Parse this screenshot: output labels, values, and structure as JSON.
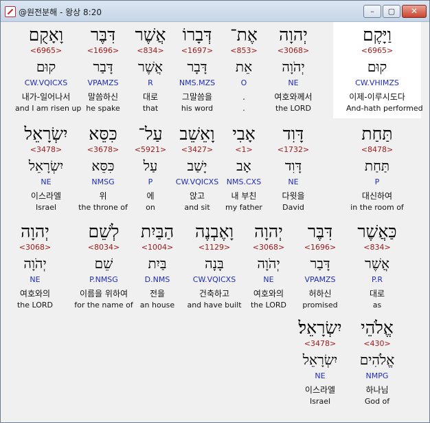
{
  "window": {
    "title": "@원전분해 - 왕상 8:20",
    "min_glyph": "–",
    "max_glyph": "▢",
    "close_glyph": "✕"
  },
  "verse": {
    "rows": [
      {
        "words": [
          {
            "hebrew": "וָאָקֻם",
            "strong": "<6965>",
            "lemma": "קוּם",
            "morph": "CW.VQICXS",
            "korean": "내가-일어나서",
            "english": "and I am risen up"
          },
          {
            "hebrew": "דִּבֶּר",
            "strong": "<1696>",
            "lemma": "דָּבַר",
            "morph": "VPAMZS",
            "korean": "말씀하신",
            "english": "he spake"
          },
          {
            "hebrew": "אֲשֶׁר",
            "strong": "<834>",
            "lemma": "אֲשֶׁר",
            "morph": "R",
            "korean": "대로",
            "english": "that"
          },
          {
            "hebrew": "דְּבָרוֹ",
            "strong": "<1697>",
            "lemma": "דָּבָר",
            "morph": "NMS.MZS",
            "korean": "그말씀을",
            "english": "his word"
          },
          {
            "hebrew": "אֶת־",
            "strong": "<853>",
            "lemma": "אֵת",
            "morph": "O",
            "korean": ".",
            "english": "."
          },
          {
            "hebrew": "יְהוָה",
            "strong": "<3068>",
            "lemma": "יְהֹוָה",
            "morph": "NE",
            "korean": "여호와께서",
            "english": "the LORD"
          },
          {
            "hebrew": "וַיָּקֶם",
            "strong": "<6965>",
            "lemma": "קוּם",
            "morph": "CW.VHIMZS",
            "korean": "이제-이루시도다",
            "english": "And-hath performed"
          }
        ]
      },
      {
        "words": [
          {
            "hebrew": "יִשְׂרָאֵל",
            "strong": "<3478>",
            "lemma": "יִשְׂרָאֵל",
            "morph": "NE",
            "korean": "이스라엘",
            "english": "Israel"
          },
          {
            "hebrew": "כִּסֵּא",
            "strong": "<3678>",
            "lemma": "כִּסֵּא",
            "morph": "NMSG",
            "korean": "위",
            "english": "the throne of"
          },
          {
            "hebrew": "עַל־",
            "strong": "<5921>",
            "lemma": "עַל",
            "morph": "P",
            "korean": "에",
            "english": "on"
          },
          {
            "hebrew": "וָאֵשֵׁב",
            "strong": "<3427>",
            "lemma": "יָשַׁב",
            "morph": "CW.VQICXS",
            "korean": "앉고",
            "english": "and sit"
          },
          {
            "hebrew": "אָבִי",
            "strong": "<1>",
            "lemma": "אָב",
            "morph": "NMS.CXS",
            "korean": "내 부친",
            "english": "my father"
          },
          {
            "hebrew": "דָּוִד",
            "strong": "<1732>",
            "lemma": "דָּוִד",
            "morph": "NE",
            "korean": "다윗을",
            "english": "David"
          },
          {
            "hebrew": "תַּחַת",
            "strong": "<8478>",
            "lemma": "תַּחַת",
            "morph": "P",
            "korean": "대신하여",
            "english": "in the room of"
          }
        ]
      },
      {
        "words": [
          {
            "hebrew": "יְהוָה",
            "strong": "<3068>",
            "lemma": "יְהֹוָה",
            "morph": "NE",
            "korean": "여호와의",
            "english": "the LORD"
          },
          {
            "hebrew": "לְשֵׁם",
            "strong": "<8034>",
            "lemma": "שֵׁם",
            "morph": "P.NMSG",
            "korean": "이름을 위하여",
            "english": "for the name of"
          },
          {
            "hebrew": "הַבַּיִת",
            "strong": "<1004>",
            "lemma": "בַּיִת",
            "morph": "D.NMS",
            "korean": "전을",
            "english": "an house"
          },
          {
            "hebrew": "וָאֶבְנֶה",
            "strong": "<1129>",
            "lemma": "בָּנָה",
            "morph": "CW.VQICXS",
            "korean": "건축하고",
            "english": "and have built"
          },
          {
            "hebrew": "יְהוָה",
            "strong": "<3068>",
            "lemma": "יְהֹוָה",
            "morph": "NE",
            "korean": "여호와의",
            "english": "the LORD"
          },
          {
            "hebrew": "דִּבֶּר",
            "strong": "<1696>",
            "lemma": "דָּבַר",
            "morph": "VPAMZS",
            "korean": "허하신",
            "english": "promised"
          },
          {
            "hebrew": "כַּאֲשֶׁר",
            "strong": "<834>",
            "lemma": "אֲשֶׁר",
            "morph": "P.R",
            "korean": "대로",
            "english": "as"
          }
        ]
      },
      {
        "words": [
          {
            "hebrew": "יִשְׂרָאֵל׃",
            "strong": "<3478>",
            "lemma": "יִשְׂרָאֵל",
            "morph": "NE",
            "korean": "이스라엘",
            "english": "Israel"
          },
          {
            "hebrew": "אֱלֹהֵי",
            "strong": "<430>",
            "lemma": "אֱלֹהִים",
            "morph": "NMPG",
            "korean": "하나님",
            "english": "God of"
          }
        ]
      }
    ]
  }
}
